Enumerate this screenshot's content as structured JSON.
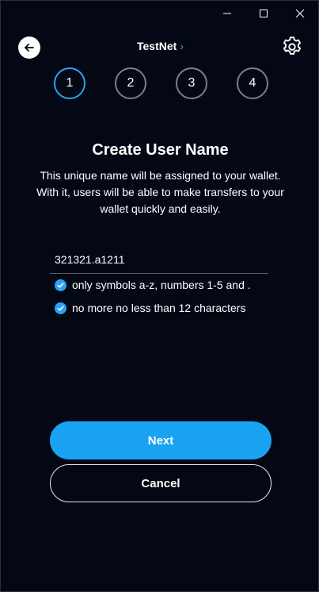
{
  "header": {
    "network_label": "TestNet",
    "network_chevron": "›"
  },
  "steps": [
    "1",
    "2",
    "3",
    "4"
  ],
  "active_step": 1,
  "main": {
    "title": "Create User Name",
    "description": "This unique name will be assigned to your wallet. With it, users will be able to make transfers to your wallet quickly and easily.",
    "username_value": "321321.a1211",
    "rules": [
      "only symbols a-z, numbers 1-5 and .",
      "no more no less than 12 characters"
    ]
  },
  "buttons": {
    "next": "Next",
    "cancel": "Cancel"
  },
  "icons": {
    "back": "arrow-left-icon",
    "settings": "gear-icon",
    "check": "check-circle-icon",
    "minimize": "minimize-icon",
    "maximize": "maximize-icon",
    "close": "close-icon"
  },
  "colors": {
    "accent": "#1aa3f2",
    "background": "#030814"
  }
}
